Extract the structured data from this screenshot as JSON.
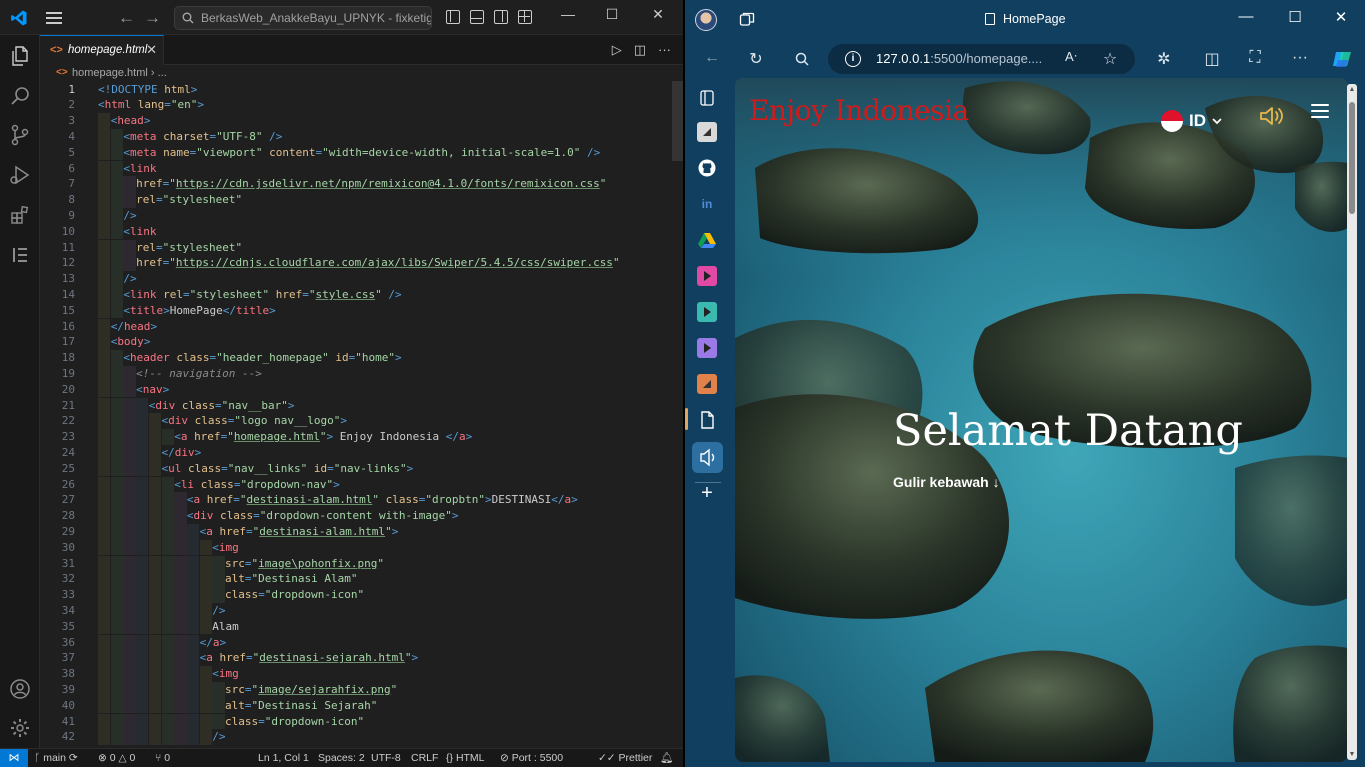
{
  "vscode": {
    "window_title": "BerkasWeb_AnakkeBayu_UPNYK - fixketiga",
    "tab_label": "homepage.html",
    "breadcrumb_file": "homepage.html",
    "breadcrumb_more": "...",
    "tab_close": "✕",
    "lines": [
      [
        1,
        0,
        [
          [
            "t",
            "<!DOCTYPE "
          ],
          [
            "at",
            "html"
          ],
          [
            "t",
            ">"
          ]
        ]
      ],
      [
        2,
        0,
        [
          [
            "t",
            "<"
          ],
          [
            "tag",
            "html "
          ],
          [
            "at",
            "lang"
          ],
          [
            "t",
            "="
          ],
          [
            "str",
            "\"en\""
          ],
          [
            "t",
            ">"
          ]
        ]
      ],
      [
        3,
        1,
        [
          [
            "t",
            "<"
          ],
          [
            "tag",
            "head"
          ],
          [
            "t",
            ">"
          ]
        ]
      ],
      [
        4,
        2,
        [
          [
            "t",
            "<"
          ],
          [
            "tag",
            "meta "
          ],
          [
            "at",
            "charset"
          ],
          [
            "t",
            "="
          ],
          [
            "str",
            "\"UTF-8\""
          ],
          [
            "t",
            " />"
          ]
        ]
      ],
      [
        5,
        2,
        [
          [
            "t",
            "<"
          ],
          [
            "tag",
            "meta "
          ],
          [
            "at",
            "name"
          ],
          [
            "t",
            "="
          ],
          [
            "str",
            "\"viewport\" "
          ],
          [
            "at",
            "content"
          ],
          [
            "t",
            "="
          ],
          [
            "str",
            "\"width=device-width, initial-scale=1.0\""
          ],
          [
            "t",
            " />"
          ]
        ]
      ],
      [
        6,
        2,
        [
          [
            "t",
            "<"
          ],
          [
            "tag",
            "link"
          ]
        ]
      ],
      [
        7,
        3,
        [
          [
            "at",
            "href"
          ],
          [
            "t",
            "="
          ],
          [
            "str",
            "\""
          ],
          [
            "stru",
            "https://cdn.jsdelivr.net/npm/remixicon@4.1.0/fonts/remixicon.css"
          ],
          [
            "str",
            "\""
          ]
        ]
      ],
      [
        8,
        3,
        [
          [
            "at",
            "rel"
          ],
          [
            "t",
            "="
          ],
          [
            "str",
            "\"stylesheet\""
          ]
        ]
      ],
      [
        9,
        2,
        [
          [
            "t",
            "/>"
          ]
        ]
      ],
      [
        10,
        2,
        [
          [
            "t",
            "<"
          ],
          [
            "tag",
            "link"
          ]
        ]
      ],
      [
        11,
        3,
        [
          [
            "at",
            "rel"
          ],
          [
            "t",
            "="
          ],
          [
            "str",
            "\"stylesheet\""
          ]
        ]
      ],
      [
        12,
        3,
        [
          [
            "at",
            "href"
          ],
          [
            "t",
            "="
          ],
          [
            "str",
            "\""
          ],
          [
            "stru",
            "https://cdnjs.cloudflare.com/ajax/libs/Swiper/5.4.5/css/swiper.css"
          ],
          [
            "str",
            "\""
          ]
        ]
      ],
      [
        13,
        2,
        [
          [
            "t",
            "/>"
          ]
        ]
      ],
      [
        14,
        2,
        [
          [
            "t",
            "<"
          ],
          [
            "tag",
            "link "
          ],
          [
            "at",
            "rel"
          ],
          [
            "t",
            "="
          ],
          [
            "str",
            "\"stylesheet\" "
          ],
          [
            "at",
            "href"
          ],
          [
            "t",
            "="
          ],
          [
            "str",
            "\""
          ],
          [
            "stru",
            "style.css"
          ],
          [
            "str",
            "\""
          ],
          [
            "t",
            " />"
          ]
        ]
      ],
      [
        15,
        2,
        [
          [
            "t",
            "<"
          ],
          [
            "tag",
            "title"
          ],
          [
            "t",
            ">"
          ],
          [
            "x",
            "HomePage"
          ],
          [
            "t",
            "</"
          ],
          [
            "tag",
            "title"
          ],
          [
            "t",
            ">"
          ]
        ]
      ],
      [
        16,
        1,
        [
          [
            "t",
            "</"
          ],
          [
            "tag",
            "head"
          ],
          [
            "t",
            ">"
          ]
        ]
      ],
      [
        17,
        1,
        [
          [
            "t",
            "<"
          ],
          [
            "tag",
            "body"
          ],
          [
            "t",
            ">"
          ]
        ]
      ],
      [
        18,
        2,
        [
          [
            "t",
            "<"
          ],
          [
            "tag",
            "header "
          ],
          [
            "at",
            "class"
          ],
          [
            "t",
            "="
          ],
          [
            "str",
            "\"header_homepage\" "
          ],
          [
            "at",
            "id"
          ],
          [
            "t",
            "="
          ],
          [
            "str",
            "\"home\""
          ],
          [
            "t",
            ">"
          ]
        ]
      ],
      [
        19,
        3,
        [
          [
            "com",
            "<!-- navigation -->"
          ]
        ]
      ],
      [
        20,
        3,
        [
          [
            "t",
            "<"
          ],
          [
            "tag",
            "nav"
          ],
          [
            "t",
            ">"
          ]
        ]
      ],
      [
        21,
        4,
        [
          [
            "t",
            "<"
          ],
          [
            "tag",
            "div "
          ],
          [
            "at",
            "class"
          ],
          [
            "t",
            "="
          ],
          [
            "str",
            "\"nav__bar\""
          ],
          [
            "t",
            ">"
          ]
        ]
      ],
      [
        22,
        5,
        [
          [
            "t",
            "<"
          ],
          [
            "tag",
            "div "
          ],
          [
            "at",
            "class"
          ],
          [
            "t",
            "="
          ],
          [
            "str",
            "\"logo nav__logo\""
          ],
          [
            "t",
            ">"
          ]
        ]
      ],
      [
        23,
        6,
        [
          [
            "t",
            "<"
          ],
          [
            "tag",
            "a "
          ],
          [
            "at",
            "href"
          ],
          [
            "t",
            "="
          ],
          [
            "str",
            "\""
          ],
          [
            "stru",
            "homepage.html"
          ],
          [
            "str",
            "\""
          ],
          [
            "t",
            ">"
          ],
          [
            "x",
            " Enjoy Indonesia "
          ],
          [
            "t",
            "</"
          ],
          [
            "tag",
            "a"
          ],
          [
            "t",
            ">"
          ]
        ]
      ],
      [
        24,
        5,
        [
          [
            "t",
            "</"
          ],
          [
            "tag",
            "div"
          ],
          [
            "t",
            ">"
          ]
        ]
      ],
      [
        25,
        5,
        [
          [
            "t",
            "<"
          ],
          [
            "tag",
            "ul "
          ],
          [
            "at",
            "class"
          ],
          [
            "t",
            "="
          ],
          [
            "str",
            "\"nav__links\" "
          ],
          [
            "at",
            "id"
          ],
          [
            "t",
            "="
          ],
          [
            "str",
            "\"nav-links\""
          ],
          [
            "t",
            ">"
          ]
        ]
      ],
      [
        26,
        6,
        [
          [
            "t",
            "<"
          ],
          [
            "tag",
            "li "
          ],
          [
            "at",
            "class"
          ],
          [
            "t",
            "="
          ],
          [
            "str",
            "\"dropdown-nav\""
          ],
          [
            "t",
            ">"
          ]
        ]
      ],
      [
        27,
        7,
        [
          [
            "t",
            "<"
          ],
          [
            "tag",
            "a "
          ],
          [
            "at",
            "href"
          ],
          [
            "t",
            "="
          ],
          [
            "str",
            "\""
          ],
          [
            "stru",
            "destinasi-alam.html"
          ],
          [
            "str",
            "\" "
          ],
          [
            "at",
            "class"
          ],
          [
            "t",
            "="
          ],
          [
            "str",
            "\"dropbtn\""
          ],
          [
            "t",
            ">"
          ],
          [
            "x",
            "DESTINASI"
          ],
          [
            "t",
            "</"
          ],
          [
            "tag",
            "a"
          ],
          [
            "t",
            ">"
          ]
        ]
      ],
      [
        28,
        7,
        [
          [
            "t",
            "<"
          ],
          [
            "tag",
            "div "
          ],
          [
            "at",
            "class"
          ],
          [
            "t",
            "="
          ],
          [
            "str",
            "\"dropdown-content with-image\""
          ],
          [
            "t",
            ">"
          ]
        ]
      ],
      [
        29,
        8,
        [
          [
            "t",
            "<"
          ],
          [
            "tag",
            "a "
          ],
          [
            "at",
            "href"
          ],
          [
            "t",
            "="
          ],
          [
            "str",
            "\""
          ],
          [
            "stru",
            "destinasi-alam.html"
          ],
          [
            "str",
            "\""
          ],
          [
            "t",
            ">"
          ]
        ]
      ],
      [
        30,
        9,
        [
          [
            "t",
            "<"
          ],
          [
            "tag",
            "img"
          ]
        ]
      ],
      [
        31,
        10,
        [
          [
            "at",
            "src"
          ],
          [
            "t",
            "="
          ],
          [
            "str",
            "\""
          ],
          [
            "stru",
            "image\\pohonfix.png"
          ],
          [
            "str",
            "\""
          ]
        ]
      ],
      [
        32,
        10,
        [
          [
            "at",
            "alt"
          ],
          [
            "t",
            "="
          ],
          [
            "str",
            "\"Destinasi Alam\""
          ]
        ]
      ],
      [
        33,
        10,
        [
          [
            "at",
            "class"
          ],
          [
            "t",
            "="
          ],
          [
            "str",
            "\"dropdown-icon\""
          ]
        ]
      ],
      [
        34,
        9,
        [
          [
            "t",
            "/>"
          ]
        ]
      ],
      [
        35,
        9,
        [
          [
            "x",
            "Alam"
          ]
        ]
      ],
      [
        36,
        8,
        [
          [
            "t",
            "</"
          ],
          [
            "tag",
            "a"
          ],
          [
            "t",
            ">"
          ]
        ]
      ],
      [
        37,
        8,
        [
          [
            "t",
            "<"
          ],
          [
            "tag",
            "a "
          ],
          [
            "at",
            "href"
          ],
          [
            "t",
            "="
          ],
          [
            "str",
            "\""
          ],
          [
            "stru",
            "destinasi-sejarah.html"
          ],
          [
            "str",
            "\""
          ],
          [
            "t",
            ">"
          ]
        ]
      ],
      [
        38,
        9,
        [
          [
            "t",
            "<"
          ],
          [
            "tag",
            "img"
          ]
        ]
      ],
      [
        39,
        10,
        [
          [
            "at",
            "src"
          ],
          [
            "t",
            "="
          ],
          [
            "str",
            "\""
          ],
          [
            "stru",
            "image/sejarahfix.png"
          ],
          [
            "str",
            "\""
          ]
        ]
      ],
      [
        40,
        10,
        [
          [
            "at",
            "alt"
          ],
          [
            "t",
            "="
          ],
          [
            "str",
            "\"Destinasi Sejarah\""
          ]
        ]
      ],
      [
        41,
        10,
        [
          [
            "at",
            "class"
          ],
          [
            "t",
            "="
          ],
          [
            "str",
            "\"dropdown-icon\""
          ]
        ]
      ],
      [
        42,
        9,
        [
          [
            "t",
            "/>"
          ]
        ]
      ]
    ],
    "status": {
      "branch": "main",
      "problems": "⊗ 0 △ 0",
      "ports": "⑂ 0",
      "cursor": "Ln 1, Col 1",
      "spaces": "Spaces: 2",
      "encoding": "UTF-8",
      "eol": "CRLF",
      "language": "HTML",
      "port": "Port : 5500",
      "formatter": "Prettier"
    }
  },
  "browser": {
    "tab_title": "HomePage",
    "url_main": "127.0.0.1",
    "url_rest": ":5500/homepage....",
    "site": {
      "logo": "Enjoy Indonesia",
      "lang": "ID",
      "hero_title": "Selamat Datang",
      "hero_sub": "Gulir kebawah ↓"
    }
  },
  "colors": {
    "vscode_accent": "#0078d4",
    "edge_frame": "#113f5f",
    "site_logo": "#d11a1a"
  }
}
